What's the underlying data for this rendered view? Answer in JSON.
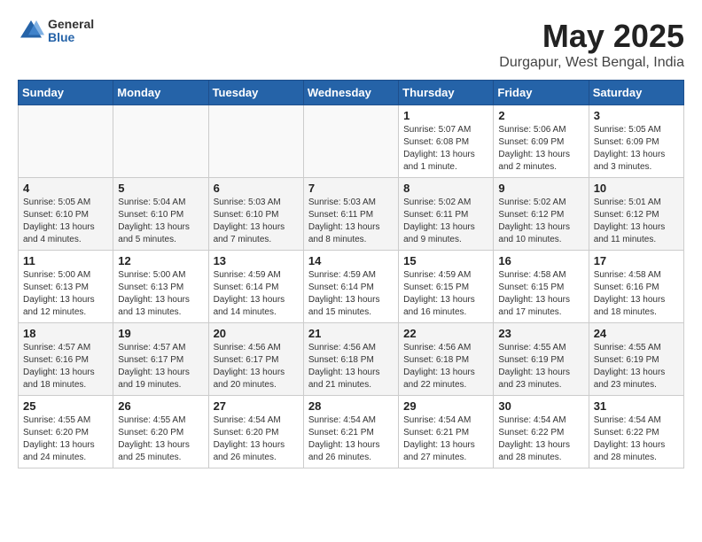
{
  "header": {
    "logo_general": "General",
    "logo_blue": "Blue",
    "month_title": "May 2025",
    "location": "Durgapur, West Bengal, India"
  },
  "weekdays": [
    "Sunday",
    "Monday",
    "Tuesday",
    "Wednesday",
    "Thursday",
    "Friday",
    "Saturday"
  ],
  "weeks": [
    [
      {
        "day": "",
        "info": ""
      },
      {
        "day": "",
        "info": ""
      },
      {
        "day": "",
        "info": ""
      },
      {
        "day": "",
        "info": ""
      },
      {
        "day": "1",
        "info": "Sunrise: 5:07 AM\nSunset: 6:08 PM\nDaylight: 13 hours\nand 1 minute."
      },
      {
        "day": "2",
        "info": "Sunrise: 5:06 AM\nSunset: 6:09 PM\nDaylight: 13 hours\nand 2 minutes."
      },
      {
        "day": "3",
        "info": "Sunrise: 5:05 AM\nSunset: 6:09 PM\nDaylight: 13 hours\nand 3 minutes."
      }
    ],
    [
      {
        "day": "4",
        "info": "Sunrise: 5:05 AM\nSunset: 6:10 PM\nDaylight: 13 hours\nand 4 minutes."
      },
      {
        "day": "5",
        "info": "Sunrise: 5:04 AM\nSunset: 6:10 PM\nDaylight: 13 hours\nand 5 minutes."
      },
      {
        "day": "6",
        "info": "Sunrise: 5:03 AM\nSunset: 6:10 PM\nDaylight: 13 hours\nand 7 minutes."
      },
      {
        "day": "7",
        "info": "Sunrise: 5:03 AM\nSunset: 6:11 PM\nDaylight: 13 hours\nand 8 minutes."
      },
      {
        "day": "8",
        "info": "Sunrise: 5:02 AM\nSunset: 6:11 PM\nDaylight: 13 hours\nand 9 minutes."
      },
      {
        "day": "9",
        "info": "Sunrise: 5:02 AM\nSunset: 6:12 PM\nDaylight: 13 hours\nand 10 minutes."
      },
      {
        "day": "10",
        "info": "Sunrise: 5:01 AM\nSunset: 6:12 PM\nDaylight: 13 hours\nand 11 minutes."
      }
    ],
    [
      {
        "day": "11",
        "info": "Sunrise: 5:00 AM\nSunset: 6:13 PM\nDaylight: 13 hours\nand 12 minutes."
      },
      {
        "day": "12",
        "info": "Sunrise: 5:00 AM\nSunset: 6:13 PM\nDaylight: 13 hours\nand 13 minutes."
      },
      {
        "day": "13",
        "info": "Sunrise: 4:59 AM\nSunset: 6:14 PM\nDaylight: 13 hours\nand 14 minutes."
      },
      {
        "day": "14",
        "info": "Sunrise: 4:59 AM\nSunset: 6:14 PM\nDaylight: 13 hours\nand 15 minutes."
      },
      {
        "day": "15",
        "info": "Sunrise: 4:59 AM\nSunset: 6:15 PM\nDaylight: 13 hours\nand 16 minutes."
      },
      {
        "day": "16",
        "info": "Sunrise: 4:58 AM\nSunset: 6:15 PM\nDaylight: 13 hours\nand 17 minutes."
      },
      {
        "day": "17",
        "info": "Sunrise: 4:58 AM\nSunset: 6:16 PM\nDaylight: 13 hours\nand 18 minutes."
      }
    ],
    [
      {
        "day": "18",
        "info": "Sunrise: 4:57 AM\nSunset: 6:16 PM\nDaylight: 13 hours\nand 18 minutes."
      },
      {
        "day": "19",
        "info": "Sunrise: 4:57 AM\nSunset: 6:17 PM\nDaylight: 13 hours\nand 19 minutes."
      },
      {
        "day": "20",
        "info": "Sunrise: 4:56 AM\nSunset: 6:17 PM\nDaylight: 13 hours\nand 20 minutes."
      },
      {
        "day": "21",
        "info": "Sunrise: 4:56 AM\nSunset: 6:18 PM\nDaylight: 13 hours\nand 21 minutes."
      },
      {
        "day": "22",
        "info": "Sunrise: 4:56 AM\nSunset: 6:18 PM\nDaylight: 13 hours\nand 22 minutes."
      },
      {
        "day": "23",
        "info": "Sunrise: 4:55 AM\nSunset: 6:19 PM\nDaylight: 13 hours\nand 23 minutes."
      },
      {
        "day": "24",
        "info": "Sunrise: 4:55 AM\nSunset: 6:19 PM\nDaylight: 13 hours\nand 23 minutes."
      }
    ],
    [
      {
        "day": "25",
        "info": "Sunrise: 4:55 AM\nSunset: 6:20 PM\nDaylight: 13 hours\nand 24 minutes."
      },
      {
        "day": "26",
        "info": "Sunrise: 4:55 AM\nSunset: 6:20 PM\nDaylight: 13 hours\nand 25 minutes."
      },
      {
        "day": "27",
        "info": "Sunrise: 4:54 AM\nSunset: 6:20 PM\nDaylight: 13 hours\nand 26 minutes."
      },
      {
        "day": "28",
        "info": "Sunrise: 4:54 AM\nSunset: 6:21 PM\nDaylight: 13 hours\nand 26 minutes."
      },
      {
        "day": "29",
        "info": "Sunrise: 4:54 AM\nSunset: 6:21 PM\nDaylight: 13 hours\nand 27 minutes."
      },
      {
        "day": "30",
        "info": "Sunrise: 4:54 AM\nSunset: 6:22 PM\nDaylight: 13 hours\nand 28 minutes."
      },
      {
        "day": "31",
        "info": "Sunrise: 4:54 AM\nSunset: 6:22 PM\nDaylight: 13 hours\nand 28 minutes."
      }
    ]
  ]
}
